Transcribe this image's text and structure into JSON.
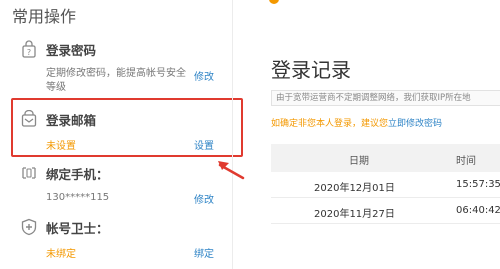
{
  "left": {
    "title": "常用操作",
    "items": [
      {
        "name": "登录密码",
        "desc_lines": [
          "定期修改密码，能提高帐号安全",
          "等级"
        ],
        "action": "修改"
      },
      {
        "name": "登录邮箱",
        "status": "未设置",
        "action": "设置"
      },
      {
        "name": "绑定手机：",
        "value": "130*****115",
        "action": "修改"
      },
      {
        "name": "帐号卫士：",
        "status": "未绑定",
        "action": "绑定"
      }
    ]
  },
  "right": {
    "title": "登录记录",
    "notice": "由于宽带运营商不定期调整网络，我们获取IP所在地",
    "hint_prefix": "如确定非您本人登录，建议您",
    "hint_link": "立即修改密码",
    "table": {
      "headers": [
        "日期",
        "时间"
      ],
      "rows": [
        [
          "2020年12月01日",
          "15:57:35"
        ],
        [
          "2020年11月27日",
          "06:40:42"
        ]
      ]
    }
  },
  "colors": {
    "accent_orange": "#f39800",
    "link_blue": "#2f84c6",
    "highlight_red": "#e03a2f"
  }
}
